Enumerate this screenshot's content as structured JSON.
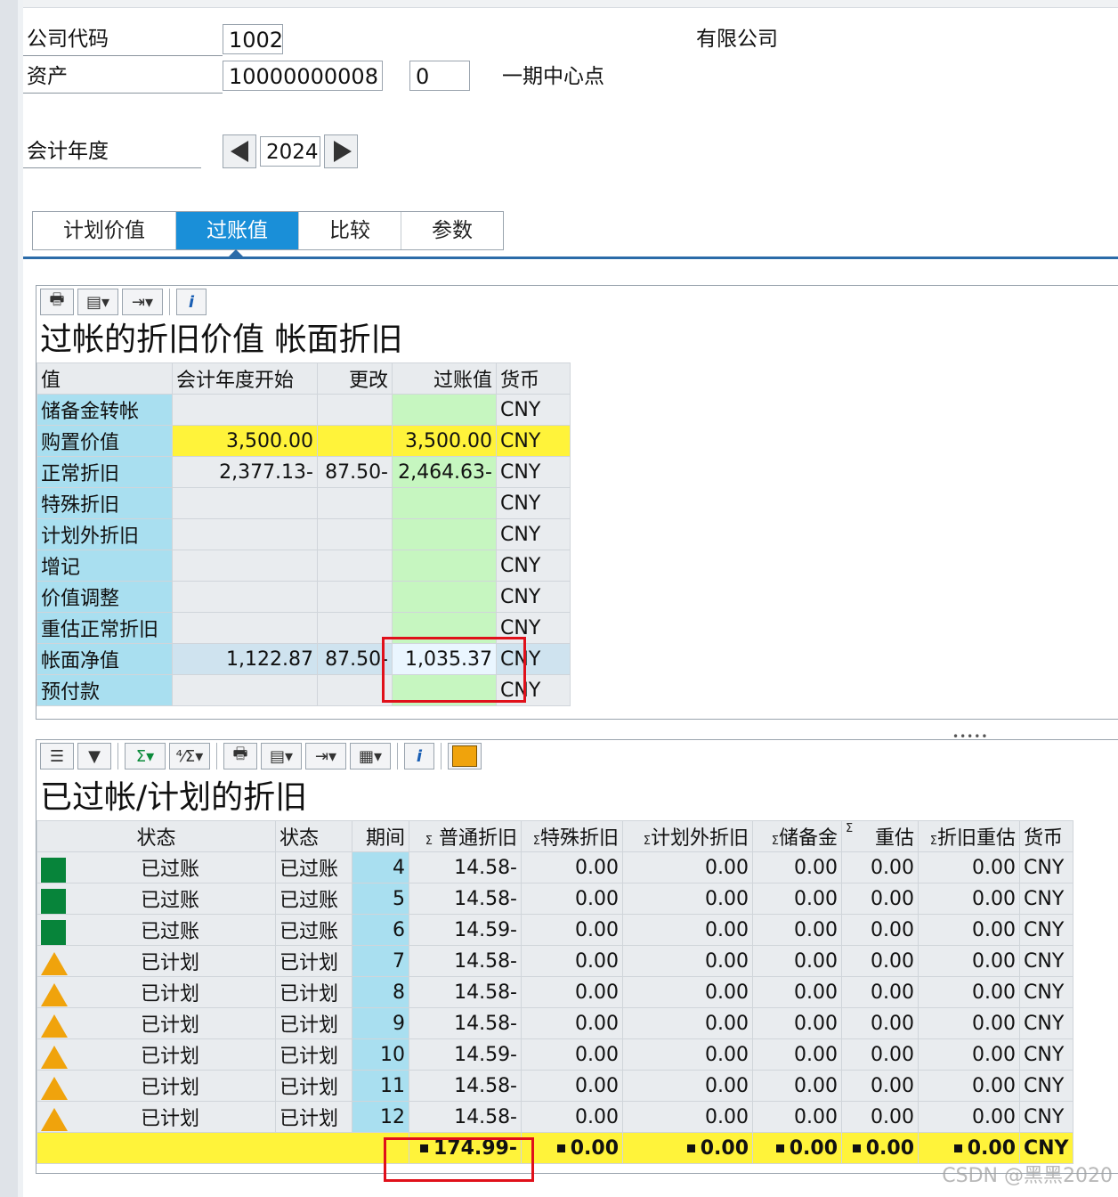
{
  "header": {
    "company_code_label": "公司代码",
    "company_code": "1002",
    "company_name": "有限公司",
    "asset_label": "资产",
    "asset_number": "10000000008",
    "asset_sub": "0",
    "asset_desc": "一期中心点",
    "fiscal_year_label": "会计年度",
    "fiscal_year": "2024"
  },
  "tabs": [
    "计划价值",
    "过账值",
    "比较",
    "参数"
  ],
  "active_tab": "过账值",
  "posted_values": {
    "title": "过帐的折旧价值 帐面折旧",
    "columns": [
      "值",
      "会计年度开始",
      "更改",
      "过账值",
      "货币"
    ],
    "rows": [
      {
        "label": "储备金转帐",
        "start": "",
        "change": "",
        "posted": "",
        "currency": "CNY"
      },
      {
        "label": "购置价值",
        "start": "3,500.00",
        "change": "",
        "posted": "3,500.00",
        "currency": "CNY"
      },
      {
        "label": "正常折旧",
        "start": "2,377.13-",
        "change": "87.50-",
        "posted": "2,464.63-",
        "currency": "CNY"
      },
      {
        "label": "特殊折旧",
        "start": "",
        "change": "",
        "posted": "",
        "currency": "CNY"
      },
      {
        "label": "计划外折旧",
        "start": "",
        "change": "",
        "posted": "",
        "currency": "CNY"
      },
      {
        "label": "增记",
        "start": "",
        "change": "",
        "posted": "",
        "currency": "CNY"
      },
      {
        "label": "价值调整",
        "start": "",
        "change": "",
        "posted": "",
        "currency": "CNY"
      },
      {
        "label": "重估正常折旧",
        "start": "",
        "change": "",
        "posted": "",
        "currency": "CNY"
      },
      {
        "label": "帐面净值",
        "start": "1,122.87",
        "change": "87.50-",
        "posted": "1,035.37",
        "currency": "CNY"
      },
      {
        "label": "预付款",
        "start": "",
        "change": "",
        "posted": "",
        "currency": "CNY"
      }
    ]
  },
  "depreciation": {
    "title": "已过帐/计划的折旧",
    "columns": [
      "状态",
      "状态",
      "期间",
      "普通折旧",
      "特殊折旧",
      "计划外折旧",
      "储备金",
      "重估",
      "折旧重估",
      "货币"
    ],
    "sum_mark": "Σ",
    "rows": [
      {
        "icon": "posted",
        "status1": "已过账",
        "status2": "已过账",
        "period": "4",
        "ordinary": "14.58-",
        "special": "0.00",
        "unplanned": "0.00",
        "reserve": "0.00",
        "reval": "0.00",
        "dep_reval": "0.00",
        "currency": "CNY"
      },
      {
        "icon": "posted",
        "status1": "已过账",
        "status2": "已过账",
        "period": "5",
        "ordinary": "14.58-",
        "special": "0.00",
        "unplanned": "0.00",
        "reserve": "0.00",
        "reval": "0.00",
        "dep_reval": "0.00",
        "currency": "CNY"
      },
      {
        "icon": "posted",
        "status1": "已过账",
        "status2": "已过账",
        "period": "6",
        "ordinary": "14.59-",
        "special": "0.00",
        "unplanned": "0.00",
        "reserve": "0.00",
        "reval": "0.00",
        "dep_reval": "0.00",
        "currency": "CNY"
      },
      {
        "icon": "planned",
        "status1": "已计划",
        "status2": "已计划",
        "period": "7",
        "ordinary": "14.58-",
        "special": "0.00",
        "unplanned": "0.00",
        "reserve": "0.00",
        "reval": "0.00",
        "dep_reval": "0.00",
        "currency": "CNY"
      },
      {
        "icon": "planned",
        "status1": "已计划",
        "status2": "已计划",
        "period": "8",
        "ordinary": "14.58-",
        "special": "0.00",
        "unplanned": "0.00",
        "reserve": "0.00",
        "reval": "0.00",
        "dep_reval": "0.00",
        "currency": "CNY"
      },
      {
        "icon": "planned",
        "status1": "已计划",
        "status2": "已计划",
        "period": "9",
        "ordinary": "14.58-",
        "special": "0.00",
        "unplanned": "0.00",
        "reserve": "0.00",
        "reval": "0.00",
        "dep_reval": "0.00",
        "currency": "CNY"
      },
      {
        "icon": "planned",
        "status1": "已计划",
        "status2": "已计划",
        "period": "10",
        "ordinary": "14.59-",
        "special": "0.00",
        "unplanned": "0.00",
        "reserve": "0.00",
        "reval": "0.00",
        "dep_reval": "0.00",
        "currency": "CNY"
      },
      {
        "icon": "planned",
        "status1": "已计划",
        "status2": "已计划",
        "period": "11",
        "ordinary": "14.58-",
        "special": "0.00",
        "unplanned": "0.00",
        "reserve": "0.00",
        "reval": "0.00",
        "dep_reval": "0.00",
        "currency": "CNY"
      },
      {
        "icon": "planned",
        "status1": "已计划",
        "status2": "已计划",
        "period": "12",
        "ordinary": "14.58-",
        "special": "0.00",
        "unplanned": "0.00",
        "reserve": "0.00",
        "reval": "0.00",
        "dep_reval": "0.00",
        "currency": "CNY"
      }
    ],
    "total": {
      "ordinary": "174.99-",
      "special": "0.00",
      "unplanned": "0.00",
      "reserve": "0.00",
      "reval": "0.00",
      "dep_reval": "0.00",
      "currency": "CNY"
    }
  },
  "colors": {
    "posted": "#07843a",
    "planned": "#f0a30c",
    "highlight": "#fff33a",
    "key": "#a9dff0",
    "green": "#c6f6c0",
    "accent": "#1a8fd8",
    "annotation": "#e0101a"
  },
  "watermark": "CSDN @黑黑2020"
}
